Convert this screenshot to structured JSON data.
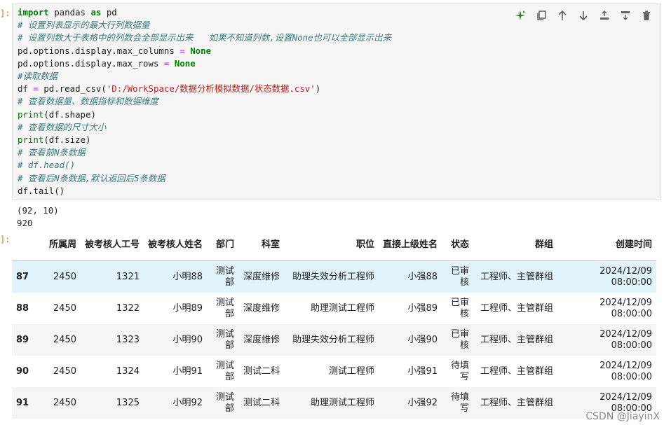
{
  "cell": {
    "in_marker": "]:",
    "out_marker": "]:",
    "code_lines": [
      [
        {
          "t": "import",
          "c": "kw"
        },
        {
          "t": " pandas "
        },
        {
          "t": "as",
          "c": "kw"
        },
        {
          "t": " pd"
        }
      ],
      [
        {
          "t": "# 设置列表显示的最大行列数据量",
          "c": "cm"
        }
      ],
      [
        {
          "t": "# 设置列数大于表格中的列数会全部显示出来   如果不知道列数,设置None也可以全部显示出来",
          "c": "cm"
        }
      ],
      [
        {
          "t": "pd.options.display.max_columns "
        },
        {
          "t": "=",
          "c": "op"
        },
        {
          "t": " "
        },
        {
          "t": "None",
          "c": "kw"
        }
      ],
      [
        {
          "t": "pd.options.display.max_rows "
        },
        {
          "t": "=",
          "c": "op"
        },
        {
          "t": " "
        },
        {
          "t": "None",
          "c": "kw"
        }
      ],
      [
        {
          "t": "#读取数据",
          "c": "cm"
        }
      ],
      [
        {
          "t": "df "
        },
        {
          "t": "=",
          "c": "op"
        },
        {
          "t": " pd.read_csv("
        },
        {
          "t": "'D:/WorkSpace/数据分析模拟数据/状态数据.csv'",
          "c": "st"
        },
        {
          "t": ")"
        }
      ],
      [
        {
          "t": "# 查看数据量、数据指标和数据维度",
          "c": "cm"
        }
      ],
      [
        {
          "t": "print",
          "c": "bi"
        },
        {
          "t": "(df.shape)"
        }
      ],
      [
        {
          "t": "# 查看数据的尺寸大小",
          "c": "cm"
        }
      ],
      [
        {
          "t": "print",
          "c": "bi"
        },
        {
          "t": "(df.size)"
        }
      ],
      [
        {
          "t": "# 查看前N条数据",
          "c": "cm"
        }
      ],
      [
        {
          "t": "# df.head()",
          "c": "cm"
        }
      ],
      [
        {
          "t": "# 查看后N条数据,默认返回后5条数据",
          "c": "cm"
        }
      ],
      [
        {
          "t": "df.tail()"
        }
      ]
    ]
  },
  "toolbar": {
    "icons": [
      "sparkle-icon",
      "duplicate-icon",
      "move-up-icon",
      "move-down-icon",
      "insert-above-icon",
      "insert-below-icon",
      "delete-icon"
    ],
    "accent": "#2e7d32"
  },
  "output": {
    "lines": [
      "(92, 10)",
      "920"
    ]
  },
  "table": {
    "columns": [
      "",
      "所属周",
      "被考核人工号",
      "被考核人姓名",
      "部门",
      "科室",
      "职位",
      "直接上级姓名",
      "状态",
      "群组",
      "创建时间"
    ],
    "rows": [
      [
        "87",
        "2450",
        "1321",
        "小明88",
        "测试部",
        "深度维修",
        "助理失效分析工程师",
        "小强88",
        "已审核",
        "工程师、主管群组",
        "2024/12/09 08:00:00"
      ],
      [
        "88",
        "2450",
        "1322",
        "小明89",
        "测试部",
        "深度维修",
        "助理测试工程师",
        "小强89",
        "已审核",
        "工程师、主管群组",
        "2024/12/09 08:00:00"
      ],
      [
        "89",
        "2450",
        "1323",
        "小明90",
        "测试部",
        "深度维修",
        "助理失效分析工程师",
        "小强90",
        "已审核",
        "工程师、主管群组",
        "2024/12/09 08:00:00"
      ],
      [
        "90",
        "2450",
        "1324",
        "小明91",
        "测试部",
        "测试二科",
        "测试工程师",
        "小强91",
        "待填写",
        "工程师、主管群组",
        "2024/12/09 08:00:00"
      ],
      [
        "91",
        "2450",
        "1325",
        "小明92",
        "测试部",
        "测试二科",
        "助理测试工程师",
        "小强92",
        "待填写",
        "工程师、主管群组",
        "2024/12/09 08:00:00"
      ]
    ],
    "highlight_row": 0
  },
  "watermark": "CSDN @JiayinX"
}
